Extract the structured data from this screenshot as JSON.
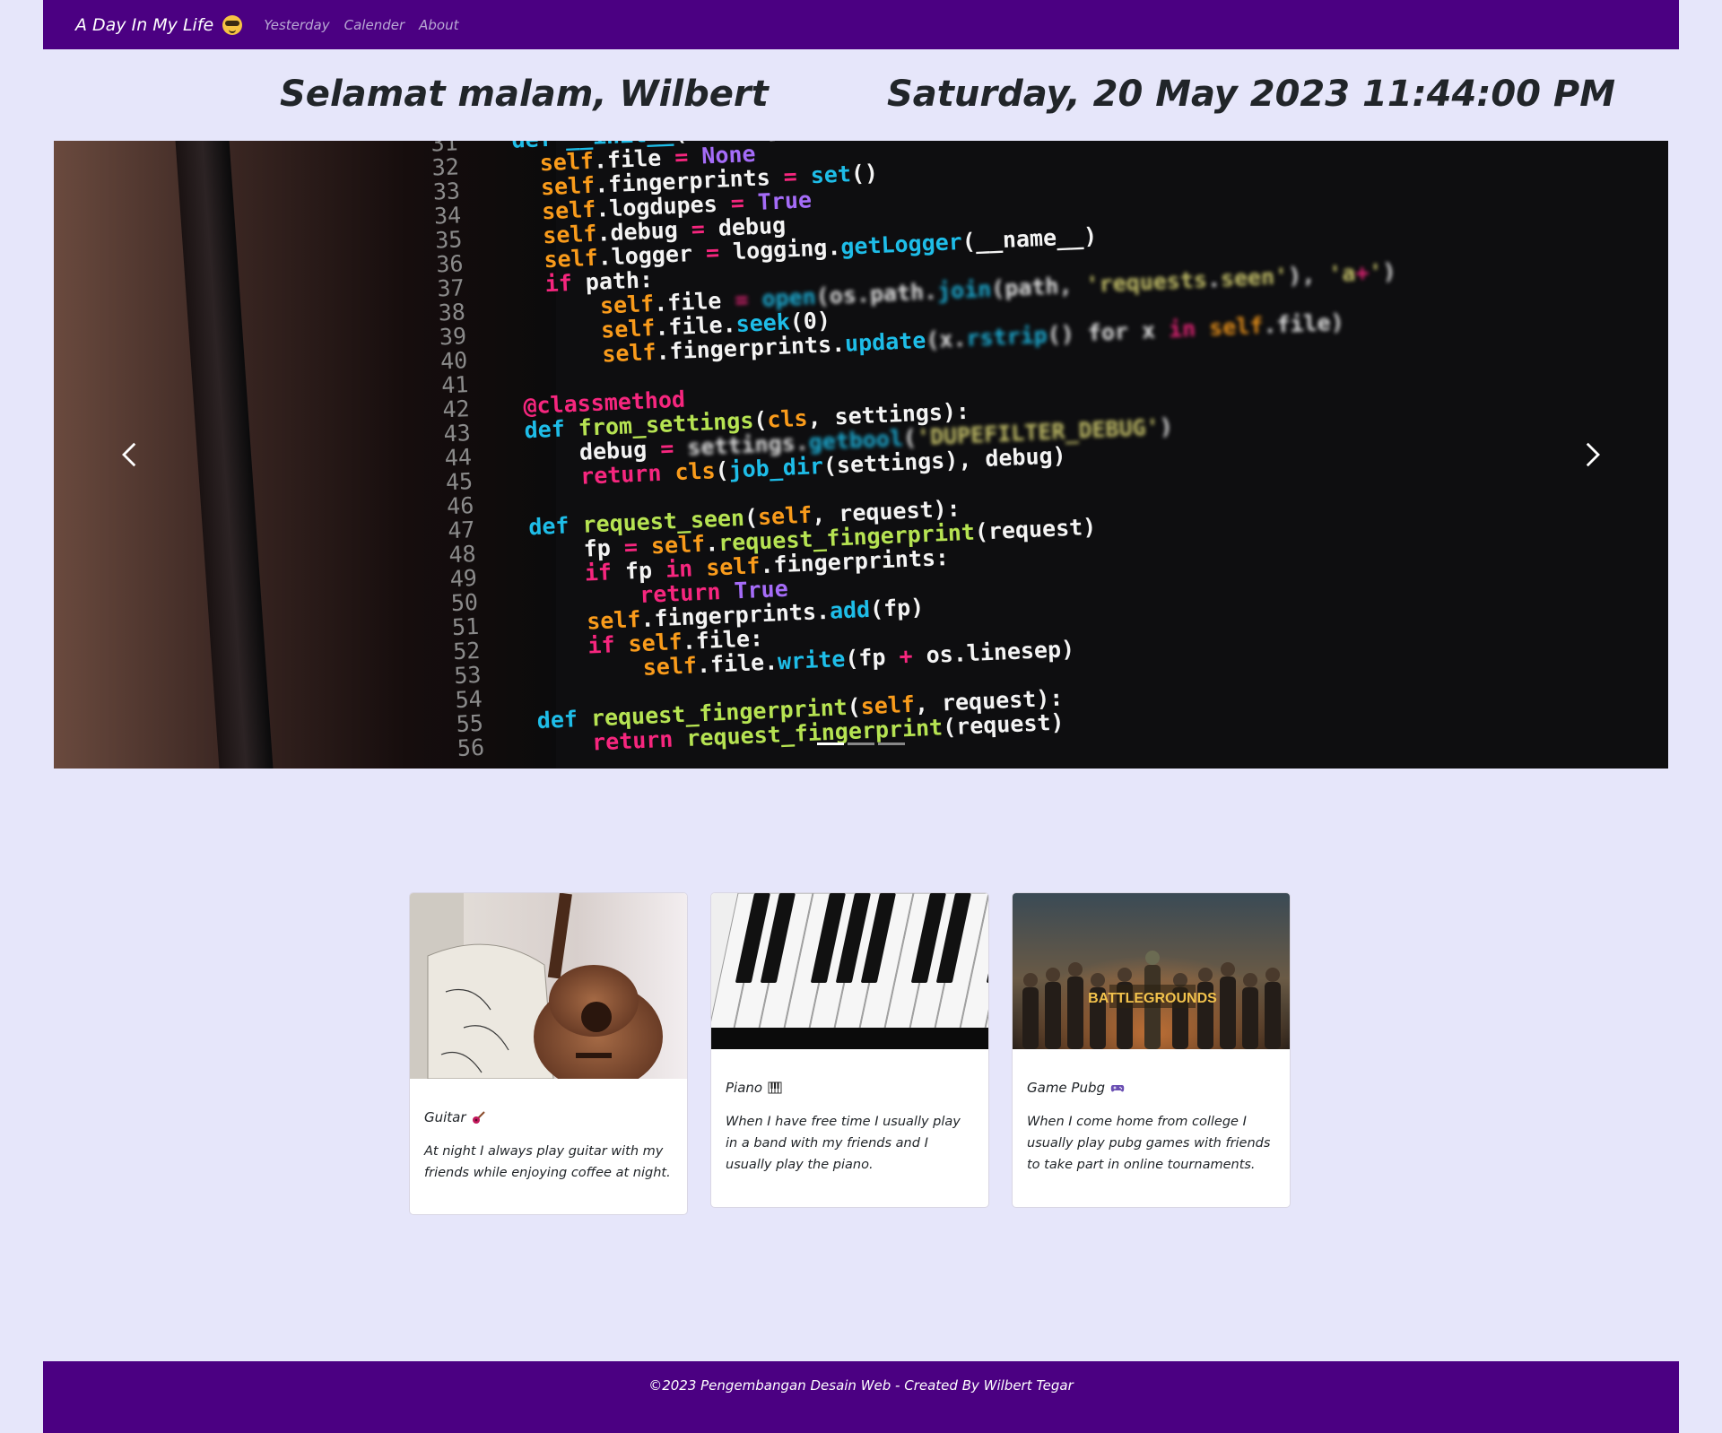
{
  "navbar": {
    "brand": "A Day In My Life",
    "brand_icon": "sunglasses-smiley-icon",
    "links": [
      "Yesterday",
      "Calender",
      "About"
    ],
    "color": "#4b0082"
  },
  "header": {
    "greeting": "Selamat malam, Wilbert",
    "datetime": "Saturday, 20 May 2023 11:44:00 PM"
  },
  "carousel": {
    "slide_image": "code-editor-photo",
    "prev_icon": "chevron-left-icon",
    "next_icon": "chevron-right-icon",
    "indicators": 3,
    "active_indicator": 1,
    "code_lines": [
      {
        "n": "31",
        "code": "def __init__(self, job_dir=None):"
      },
      {
        "n": "32",
        "code": "  self.file = None"
      },
      {
        "n": "33",
        "code": "  self.fingerprints = set()"
      },
      {
        "n": "34",
        "code": "  self.logdupes = True"
      },
      {
        "n": "35",
        "code": "  self.debug = debug"
      },
      {
        "n": "36",
        "code": "  self.logger = logging.getLogger(__name__)"
      },
      {
        "n": "37",
        "code": "  if path:"
      },
      {
        "n": "38",
        "code": "      self.file = open(os.path.join(path, 'requests.seen'), 'a+')"
      },
      {
        "n": "39",
        "code": "      self.file.seek(0)"
      },
      {
        "n": "40",
        "code": "      self.fingerprints.update(x.rstrip() for x in self.file)"
      },
      {
        "n": "41",
        "code": ""
      },
      {
        "n": "42",
        "code": "@classmethod"
      },
      {
        "n": "43",
        "code": "def from_settings(cls, settings):"
      },
      {
        "n": "44",
        "code": "    debug = settings.getbool('DUPEFILTER_DEBUG')"
      },
      {
        "n": "45",
        "code": "    return cls(job_dir(settings), debug)"
      },
      {
        "n": "46",
        "code": ""
      },
      {
        "n": "47",
        "code": "def request_seen(self, request):"
      },
      {
        "n": "48",
        "code": "    fp = self.request_fingerprint(request)"
      },
      {
        "n": "49",
        "code": "    if fp in self.fingerprints:"
      },
      {
        "n": "50",
        "code": "        return True"
      },
      {
        "n": "51",
        "code": "    self.fingerprints.add(fp)"
      },
      {
        "n": "52",
        "code": "    if self.file:"
      },
      {
        "n": "53",
        "code": "        self.file.write(fp + os.linesep)"
      },
      {
        "n": "54",
        "code": ""
      },
      {
        "n": "55",
        "code": "def request_fingerprint(self, request):"
      },
      {
        "n": "56",
        "code": "    return request_fingerprint(request)"
      }
    ]
  },
  "cards": [
    {
      "title": "Guitar",
      "icon": "guitar-icon",
      "image": "acoustic-guitar-photo",
      "text": "At night I always play guitar with my friends while enjoying coffee at night."
    },
    {
      "title": "Piano",
      "icon": "piano-keys-icon",
      "image": "piano-keys-photo",
      "text": "When I have free time I usually play in a band with my friends and I usually play the piano."
    },
    {
      "title": "Game Pubg",
      "icon": "game-controller-icon",
      "image": "pubg-battlegrounds-poster",
      "poster_title": "BATTLEGROUNDS",
      "text": "When I come home from college I usually play pubg games with friends to take part in online tournaments."
    }
  ],
  "footer": {
    "text": "©2023 Pengembangan Desain Web - Created By Wilbert Tegar"
  }
}
